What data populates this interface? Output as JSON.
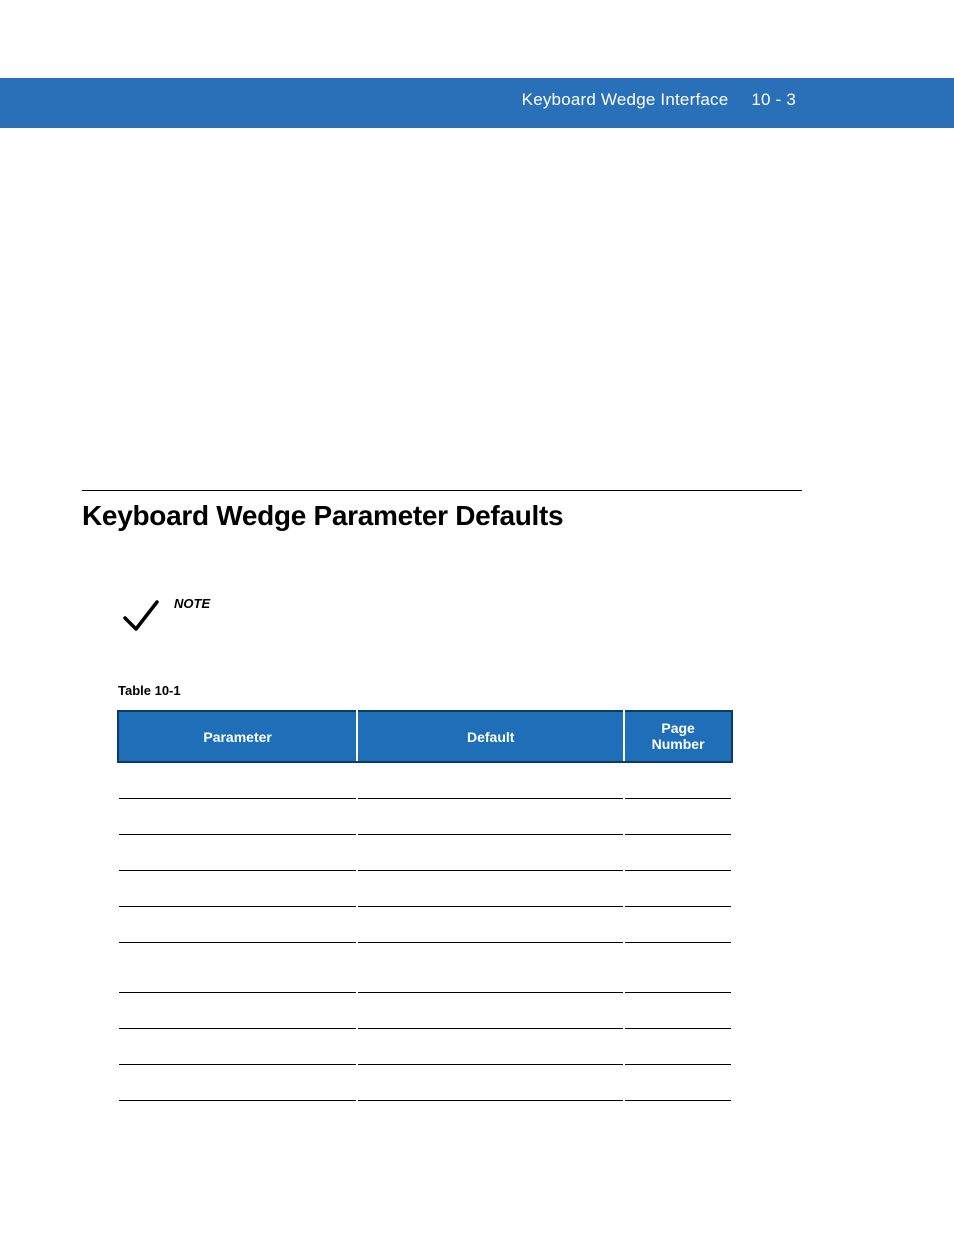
{
  "header": {
    "title": "Keyboard Wedge Interface",
    "page_number": "10 - 3"
  },
  "section": {
    "heading": "Keyboard Wedge Parameter Defaults"
  },
  "note": {
    "label": "NOTE"
  },
  "table": {
    "caption": "Table 10-1",
    "columns": {
      "parameter": "Parameter",
      "default": "Default",
      "page_number_line1": "Page",
      "page_number_line2": "Number"
    },
    "rows": [
      {
        "parameter": "",
        "default": "",
        "page_number": ""
      },
      {
        "parameter": "",
        "default": "",
        "page_number": ""
      },
      {
        "parameter": "",
        "default": "",
        "page_number": ""
      },
      {
        "parameter": "",
        "default": "",
        "page_number": ""
      },
      {
        "parameter": "",
        "default": "",
        "page_number": ""
      },
      {
        "parameter": "",
        "default": "",
        "page_number": ""
      },
      {
        "parameter": "",
        "default": "",
        "page_number": ""
      },
      {
        "parameter": "",
        "default": "",
        "page_number": ""
      },
      {
        "parameter": "",
        "default": "",
        "page_number": ""
      }
    ]
  }
}
